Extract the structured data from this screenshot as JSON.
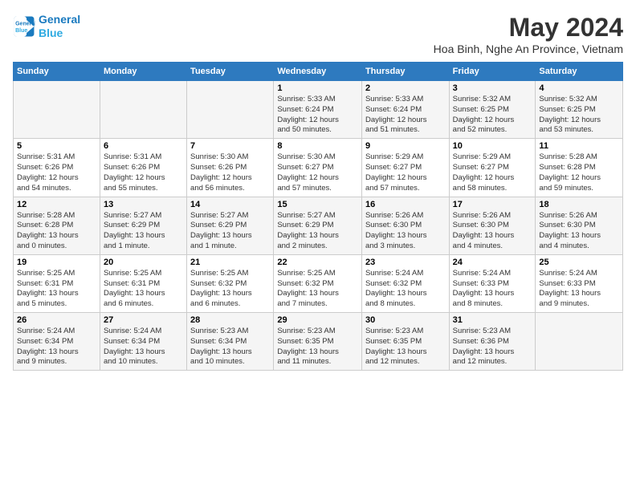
{
  "logo": {
    "line1": "General",
    "line2": "Blue"
  },
  "title": "May 2024",
  "subtitle": "Hoa Binh, Nghe An Province, Vietnam",
  "headers": [
    "Sunday",
    "Monday",
    "Tuesday",
    "Wednesday",
    "Thursday",
    "Friday",
    "Saturday"
  ],
  "weeks": [
    [
      {
        "day": "",
        "info": ""
      },
      {
        "day": "",
        "info": ""
      },
      {
        "day": "",
        "info": ""
      },
      {
        "day": "1",
        "info": "Sunrise: 5:33 AM\nSunset: 6:24 PM\nDaylight: 12 hours\nand 50 minutes."
      },
      {
        "day": "2",
        "info": "Sunrise: 5:33 AM\nSunset: 6:24 PM\nDaylight: 12 hours\nand 51 minutes."
      },
      {
        "day": "3",
        "info": "Sunrise: 5:32 AM\nSunset: 6:25 PM\nDaylight: 12 hours\nand 52 minutes."
      },
      {
        "day": "4",
        "info": "Sunrise: 5:32 AM\nSunset: 6:25 PM\nDaylight: 12 hours\nand 53 minutes."
      }
    ],
    [
      {
        "day": "5",
        "info": "Sunrise: 5:31 AM\nSunset: 6:26 PM\nDaylight: 12 hours\nand 54 minutes."
      },
      {
        "day": "6",
        "info": "Sunrise: 5:31 AM\nSunset: 6:26 PM\nDaylight: 12 hours\nand 55 minutes."
      },
      {
        "day": "7",
        "info": "Sunrise: 5:30 AM\nSunset: 6:26 PM\nDaylight: 12 hours\nand 56 minutes."
      },
      {
        "day": "8",
        "info": "Sunrise: 5:30 AM\nSunset: 6:27 PM\nDaylight: 12 hours\nand 57 minutes."
      },
      {
        "day": "9",
        "info": "Sunrise: 5:29 AM\nSunset: 6:27 PM\nDaylight: 12 hours\nand 57 minutes."
      },
      {
        "day": "10",
        "info": "Sunrise: 5:29 AM\nSunset: 6:27 PM\nDaylight: 12 hours\nand 58 minutes."
      },
      {
        "day": "11",
        "info": "Sunrise: 5:28 AM\nSunset: 6:28 PM\nDaylight: 12 hours\nand 59 minutes."
      }
    ],
    [
      {
        "day": "12",
        "info": "Sunrise: 5:28 AM\nSunset: 6:28 PM\nDaylight: 13 hours\nand 0 minutes."
      },
      {
        "day": "13",
        "info": "Sunrise: 5:27 AM\nSunset: 6:29 PM\nDaylight: 13 hours\nand 1 minute."
      },
      {
        "day": "14",
        "info": "Sunrise: 5:27 AM\nSunset: 6:29 PM\nDaylight: 13 hours\nand 1 minute."
      },
      {
        "day": "15",
        "info": "Sunrise: 5:27 AM\nSunset: 6:29 PM\nDaylight: 13 hours\nand 2 minutes."
      },
      {
        "day": "16",
        "info": "Sunrise: 5:26 AM\nSunset: 6:30 PM\nDaylight: 13 hours\nand 3 minutes."
      },
      {
        "day": "17",
        "info": "Sunrise: 5:26 AM\nSunset: 6:30 PM\nDaylight: 13 hours\nand 4 minutes."
      },
      {
        "day": "18",
        "info": "Sunrise: 5:26 AM\nSunset: 6:30 PM\nDaylight: 13 hours\nand 4 minutes."
      }
    ],
    [
      {
        "day": "19",
        "info": "Sunrise: 5:25 AM\nSunset: 6:31 PM\nDaylight: 13 hours\nand 5 minutes."
      },
      {
        "day": "20",
        "info": "Sunrise: 5:25 AM\nSunset: 6:31 PM\nDaylight: 13 hours\nand 6 minutes."
      },
      {
        "day": "21",
        "info": "Sunrise: 5:25 AM\nSunset: 6:32 PM\nDaylight: 13 hours\nand 6 minutes."
      },
      {
        "day": "22",
        "info": "Sunrise: 5:25 AM\nSunset: 6:32 PM\nDaylight: 13 hours\nand 7 minutes."
      },
      {
        "day": "23",
        "info": "Sunrise: 5:24 AM\nSunset: 6:32 PM\nDaylight: 13 hours\nand 8 minutes."
      },
      {
        "day": "24",
        "info": "Sunrise: 5:24 AM\nSunset: 6:33 PM\nDaylight: 13 hours\nand 8 minutes."
      },
      {
        "day": "25",
        "info": "Sunrise: 5:24 AM\nSunset: 6:33 PM\nDaylight: 13 hours\nand 9 minutes."
      }
    ],
    [
      {
        "day": "26",
        "info": "Sunrise: 5:24 AM\nSunset: 6:34 PM\nDaylight: 13 hours\nand 9 minutes."
      },
      {
        "day": "27",
        "info": "Sunrise: 5:24 AM\nSunset: 6:34 PM\nDaylight: 13 hours\nand 10 minutes."
      },
      {
        "day": "28",
        "info": "Sunrise: 5:23 AM\nSunset: 6:34 PM\nDaylight: 13 hours\nand 10 minutes."
      },
      {
        "day": "29",
        "info": "Sunrise: 5:23 AM\nSunset: 6:35 PM\nDaylight: 13 hours\nand 11 minutes."
      },
      {
        "day": "30",
        "info": "Sunrise: 5:23 AM\nSunset: 6:35 PM\nDaylight: 13 hours\nand 12 minutes."
      },
      {
        "day": "31",
        "info": "Sunrise: 5:23 AM\nSunset: 6:36 PM\nDaylight: 13 hours\nand 12 minutes."
      },
      {
        "day": "",
        "info": ""
      }
    ]
  ]
}
